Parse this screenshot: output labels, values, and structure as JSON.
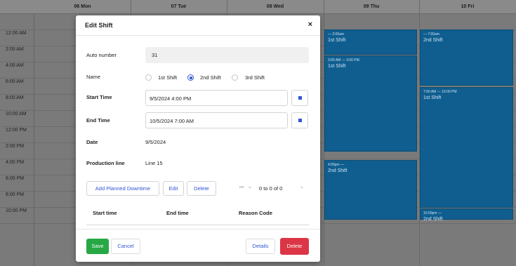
{
  "scheduler": {
    "days": [
      "06 Mon",
      "07 Tue",
      "08 Wed",
      "09 Thu",
      "10 Fri"
    ],
    "times": [
      "12:00 AM",
      "2:00 AM",
      "4:00 AM",
      "6:00 AM",
      "8:00 AM",
      "10:00 AM",
      "12:00 PM",
      "2:00 PM",
      "4:00 PM",
      "6:00 PM",
      "8:00 PM",
      "10:00 PM"
    ],
    "events": [
      {
        "time": "— 3:00am",
        "name": "1st Shift"
      },
      {
        "time": "3:00 AM — 3:00 PM",
        "name": "1st Shift"
      },
      {
        "time": "4:00pm —",
        "name": "2nd Shift"
      },
      {
        "time": "— 7:00am",
        "name": "2nd Shift"
      },
      {
        "time": "7:00 AM — 10:00 PM",
        "name": "1st Shift"
      },
      {
        "time": "10:00pm —",
        "name": "2nd Shift"
      }
    ]
  },
  "modal": {
    "title": "Edit Shift",
    "close": "×",
    "auto_number_label": "Auto number",
    "auto_number_value": "31",
    "name_label": "Name",
    "shift_options": [
      "1st Shift",
      "2nd Shift",
      "3rd Shift"
    ],
    "selected_shift": "2nd Shift",
    "start_label": "Start Time",
    "start_value": "9/5/2024 4:00 PM",
    "end_label": "End Time",
    "end_value": "10/5/2024 7:00 AM",
    "date_label": "Date",
    "date_value": "9/5/2024",
    "line_label": "Production line",
    "line_value": "Line 15",
    "add_downtime": "Add Planned Downtime",
    "edit": "Edit",
    "delete_small": "Delete",
    "pager_first": "⏮",
    "pager_prev": "«",
    "pager_text": "0 to 0 of 0",
    "pager_next": "»",
    "columns": [
      "Start time",
      "End time",
      "Reason Code"
    ],
    "save": "Save",
    "cancel": "Cancel",
    "details": "Details",
    "delete": "Delete"
  }
}
